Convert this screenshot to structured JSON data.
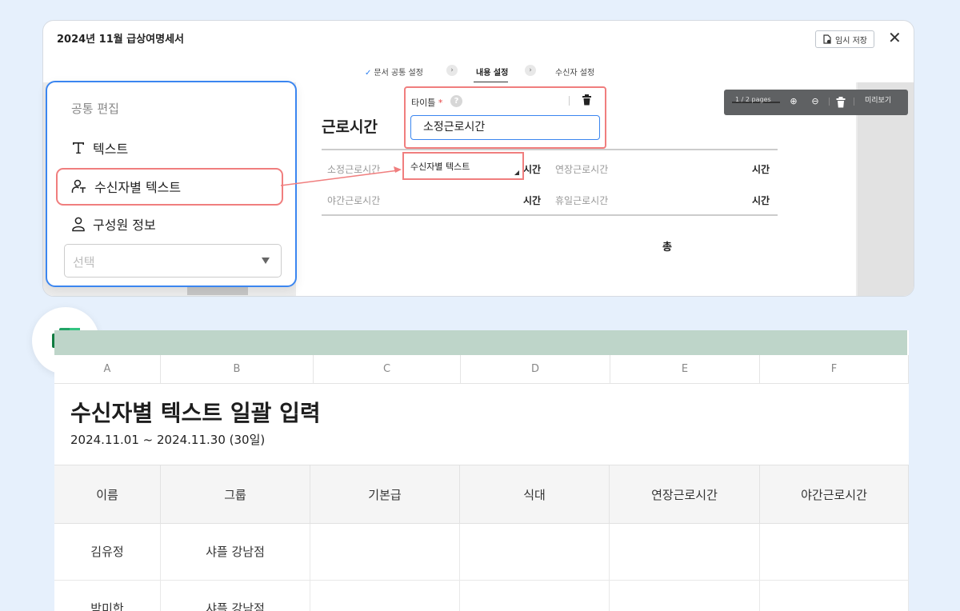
{
  "editor": {
    "doc_title": "2024년 11월 급상여명세서",
    "save_label": "임시 저장",
    "steps": [
      "문서 공통 설정",
      "내용 설정",
      "수신자 설정"
    ],
    "section_title": "근로시간",
    "rows": [
      {
        "left_label": "소정근로시간",
        "left_unit": "시간",
        "right_label": "연장근로시간",
        "right_unit": "시간"
      },
      {
        "left_label": "야간근로시간",
        "left_unit": "시간",
        "right_label": "휴일근로시간",
        "right_unit": "시간"
      }
    ],
    "total_label": "총",
    "title_popup": {
      "label": "타이틀",
      "required_mark": "*",
      "help": "?",
      "value": "소정근로시간"
    },
    "field_box_text": "수신자별 텍스트",
    "pager": {
      "page_text": "1 / 2 pages",
      "preview_label": "미리보기"
    }
  },
  "panel": {
    "heading": "공통 편집",
    "items": [
      "텍스트",
      "수신자별 텍스트",
      "구성원 정보"
    ],
    "select_placeholder": "선택"
  },
  "sheet": {
    "columns": [
      "A",
      "B",
      "C",
      "D",
      "E",
      "F"
    ],
    "title": "수신자별 텍스트 일괄 입력",
    "period": "2024.11.01 ~ 2024.11.30 (30일)",
    "headers": [
      "이름",
      "그룹",
      "기본급",
      "식대",
      "연장근로시간",
      "야간근로시간"
    ],
    "rows": [
      [
        "김유정",
        "샤플 강남점",
        "",
        "",
        "",
        ""
      ],
      [
        "박미한",
        "샤플 강남점",
        "",
        "",
        "",
        ""
      ]
    ]
  },
  "colors": {
    "accent": "#3b86f0",
    "highlight": "#f07e7e",
    "excel_green": "#1f7244",
    "sheet_bar": "#bed5c9"
  }
}
